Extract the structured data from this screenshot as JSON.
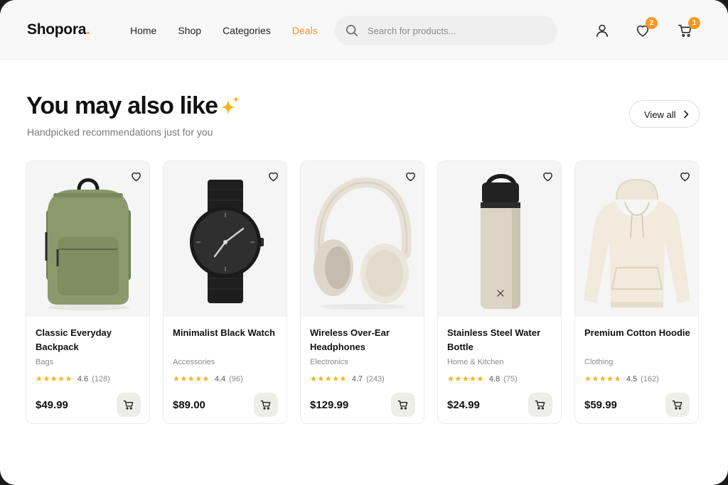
{
  "header": {
    "logo": "Shopora",
    "logo_dot": ".",
    "nav": [
      {
        "label": "Home",
        "active": false
      },
      {
        "label": "Shop",
        "active": false
      },
      {
        "label": "Categories",
        "active": false
      },
      {
        "label": "Deals",
        "active": true
      }
    ],
    "search_placeholder": "Search for products...",
    "wishlist_count": "2",
    "cart_count": "1",
    "accent_color": "#f59a23"
  },
  "section": {
    "title": "You may also like",
    "subtitle": "Handpicked recommendations just for you",
    "view_all_label": "View all"
  },
  "products": [
    {
      "name": "Classic Everyday Backpack",
      "category": "Bags",
      "stars": "★★★★★",
      "rating": "4.6",
      "reviews": "(128)",
      "price": "$49.99",
      "image_icon": "backpack-image"
    },
    {
      "name": "Minimalist Black Watch",
      "category": "Accessories",
      "stars": "★★★★★",
      "rating": "4.4",
      "reviews": "(96)",
      "price": "$89.00",
      "image_icon": "watch-image"
    },
    {
      "name": "Wireless Over-Ear Headphones",
      "category": "Electronics",
      "stars": "★★★★★",
      "rating": "4.7",
      "reviews": "(243)",
      "price": "$129.99",
      "image_icon": "headphones-image"
    },
    {
      "name": "Stainless Steel Water Bottle",
      "category": "Home & Kitchen",
      "stars": "★★★★★",
      "rating": "4.8",
      "reviews": "(75)",
      "price": "$24.99",
      "image_icon": "bottle-image"
    },
    {
      "name": "Premium Cotton Hoodie",
      "category": "Clothing",
      "stars": "★★★★★",
      "rating": "4.5",
      "reviews": "(162)",
      "price": "$59.99",
      "image_icon": "hoodie-image"
    }
  ]
}
